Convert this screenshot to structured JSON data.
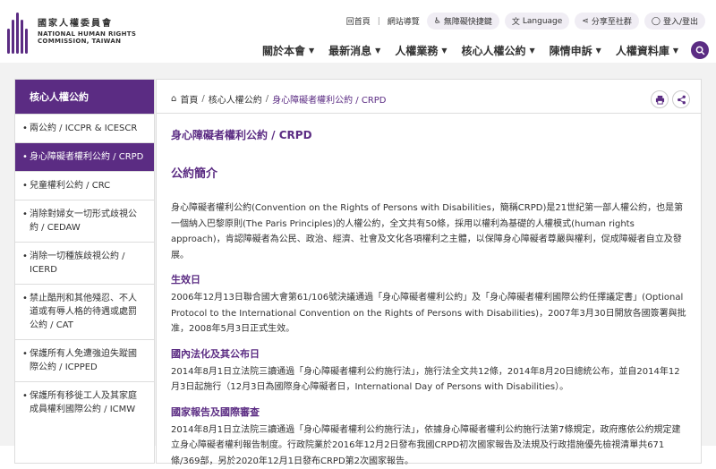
{
  "header": {
    "logo_cn": "國家人權委員會",
    "logo_en_1": "NATIONAL HUMAN RIGHTS",
    "logo_en_2": "COMMISSION, TAIWAN",
    "util": {
      "home": "回首頁",
      "sitemap": "網站導覽",
      "accessible": "無障礙快捷鍵",
      "language": "Language",
      "share": "分享至社群",
      "login": "登入/登出"
    },
    "nav": [
      "關於本會",
      "最新消息",
      "人權業務",
      "核心人權公約",
      "陳情申訴",
      "人權資料庫"
    ],
    "colors": {
      "brand": "#5b2c83"
    }
  },
  "sidebar": {
    "title": "核心人權公約",
    "items": [
      {
        "label": "兩公約 / ICCPR & ICESCR"
      },
      {
        "label": "身心障礙者權利公約 / CRPD"
      },
      {
        "label": "兒童權利公約 / CRC"
      },
      {
        "label": "消除對婦女一切形式歧視公約 / CEDAW"
      },
      {
        "label": "消除一切種族歧視公約 / ICERD"
      },
      {
        "label": "禁止酷刑和其他殘忍、不人道或有辱人格的待遇或處罰公約 / CAT"
      },
      {
        "label": "保護所有人免遭強迫失蹤國際公約 / ICPPED"
      },
      {
        "label": "保護所有移徙工人及其家庭成員權利國際公約 / ICMW"
      }
    ]
  },
  "breadcrumb": {
    "home": "首頁",
    "level1": "核心人權公約",
    "current": "身心障礙者權利公約 / CRPD"
  },
  "content": {
    "title": "身心障礙者權利公約 / CRPD",
    "section_title": "公約簡介",
    "intro": "身心障礙者權利公約(Convention on the Rights of Persons with Disabilities，簡稱CRPD)是21世紀第一部人權公約，也是第一個納入巴黎原則(The Paris Principles)的人權公約，全文共有50條，採用以權利為基礎的人權模式(human rights approach)，肯認障礙者為公民、政治、經濟、社會及文化各項權利之主體，以保障身心障礙者尊嚴與權利，促成障礙者自立及發展。",
    "effective_title": "生效日",
    "effective_text": "2006年12月13日聯合國大會第61/106號決議通過「身心障礙者權利公約」及「身心障礙者權利國際公約任擇議定書」(Optional Protocol to the International Convention on the Rights of Persons with Disabilities)，2007年3月30日開放各國簽署與批准，2008年5月3日正式生效。",
    "domestic_title": "國內法化及其公布日",
    "domestic_text": "2014年8月1日立法院三讀通過「身心障礙者權利公約施行法」，施行法全文共12條，2014年8月20日總統公布，並自2014年12月3日起施行（12月3日為國際身心障礙者日，International Day of Persons with Disabilities）。",
    "report_title": "國家報告及國際審查",
    "report_text": "2014年8月1日立法院三讀通過「身心障礙者權利公約施行法」，依據身心障礙者權利公約施行法第7條規定，政府應依公約規定建立身心障礙者權利報告制度。行政院業於2016年12月2日發布我國CRPD初次國家報告及法規及行政措施優先檢視清單共671條/369部，另於2020年12月1日發布CRPD第2次國家報告。"
  }
}
